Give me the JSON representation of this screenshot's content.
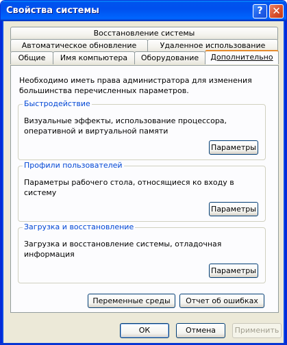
{
  "window": {
    "title": "Свойства системы",
    "help_glyph": "?",
    "close_glyph": "✕"
  },
  "tabs": {
    "row1": [
      {
        "label": "Восстановление системы"
      }
    ],
    "row2": [
      {
        "label": "Автоматическое обновление"
      },
      {
        "label": "Удаленное использование"
      }
    ],
    "row3": [
      {
        "label": "Общие"
      },
      {
        "label": "Имя компьютера"
      },
      {
        "label": "Оборудование"
      },
      {
        "label": "Дополнительно",
        "active": true
      }
    ]
  },
  "panel": {
    "intro": "Необходимо иметь права администратора для изменения большинства перечисленных параметров.",
    "groups": [
      {
        "title": "Быстродействие",
        "description": "Визуальные эффекты, использование процессора, оперативной и виртуальной памяти",
        "button": "Параметры"
      },
      {
        "title": "Профили пользователей",
        "description": "Параметры рабочего стола, относящиеся ко входу в систему",
        "button": "Параметры"
      },
      {
        "title": "Загрузка и восстановление",
        "description": "Загрузка и восстановление системы, отладочная информация",
        "button": "Параметры"
      }
    ],
    "env_button": "Переменные среды",
    "error_report_button": "Отчет об ошибках"
  },
  "footer": {
    "ok": "ОК",
    "cancel": "Отмена",
    "apply": "Применить"
  },
  "colors": {
    "titlebar": "#0054e3",
    "dialog_bg": "#ece9d8",
    "group_title": "#0046d5",
    "active_tab_accent": "#e68b2c"
  }
}
